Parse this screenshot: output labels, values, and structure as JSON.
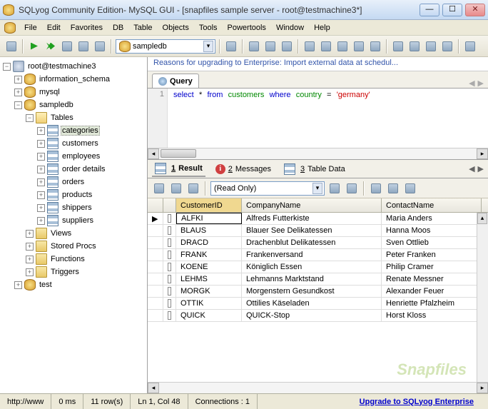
{
  "title": "SQLyog Community Edition- MySQL GUI - [snapfiles sample server - root@testmachine3*]",
  "menu": [
    "File",
    "Edit",
    "Favorites",
    "DB",
    "Table",
    "Objects",
    "Tools",
    "Powertools",
    "Window",
    "Help"
  ],
  "db_selector": "sampledb",
  "banner": "Reasons for upgrading to Enterprise: Import external data at schedul...",
  "query_tab": "Query",
  "sql": {
    "line": "1",
    "kw1": "select",
    "star": "*",
    "kw2": "from",
    "tbl": "customers",
    "kw3": "where",
    "col": "country",
    "eq": "=",
    "lit": "'germany'"
  },
  "tree": {
    "root": "root@testmachine3",
    "dbs": [
      "information_schema",
      "mysql",
      "sampledb",
      "test"
    ],
    "sampledb_children": [
      "Tables",
      "Views",
      "Stored Procs",
      "Functions",
      "Triggers"
    ],
    "tables": [
      "categories",
      "customers",
      "employees",
      "order details",
      "orders",
      "products",
      "shippers",
      "suppliers"
    ],
    "selected_table": "categories"
  },
  "result_tabs": {
    "r1_num": "1",
    "r1": "Result",
    "r2_num": "2",
    "r2": "Messages",
    "r3_num": "3",
    "r3": "Table Data"
  },
  "readonly": "(Read Only)",
  "columns": [
    "CustomerID",
    "CompanyName",
    "ContactName"
  ],
  "rows": [
    {
      "id": "ALFKI",
      "company": "Alfreds Futterkiste",
      "contact": "Maria Anders"
    },
    {
      "id": "BLAUS",
      "company": "Blauer See Delikatessen",
      "contact": "Hanna Moos"
    },
    {
      "id": "DRACD",
      "company": "Drachenblut Delikatessen",
      "contact": "Sven Ottlieb"
    },
    {
      "id": "FRANK",
      "company": "Frankenversand",
      "contact": "Peter Franken"
    },
    {
      "id": "KOENE",
      "company": "Königlich Essen",
      "contact": "Philip Cramer"
    },
    {
      "id": "LEHMS",
      "company": "Lehmanns Marktstand",
      "contact": "Renate Messner"
    },
    {
      "id": "MORGK",
      "company": "Morgenstern Gesundkost",
      "contact": "Alexander Feuer"
    },
    {
      "id": "OTTIK",
      "company": "Ottilies Käseladen",
      "contact": "Henriette Pfalzheim"
    },
    {
      "id": "QUICK",
      "company": "QUICK-Stop",
      "contact": "Horst Kloss"
    }
  ],
  "status": {
    "url": "http://www",
    "time": "0 ms",
    "rows": "11 row(s)",
    "pos": "Ln 1, Col 48",
    "conn": "Connections : 1",
    "upgrade": "Upgrade to SQLyog Enterprise"
  },
  "watermark": "Snapfiles"
}
